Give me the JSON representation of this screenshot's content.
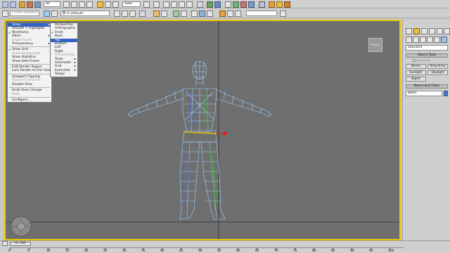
{
  "toolbar": {
    "filter_value": "All",
    "refcoord_value": "View",
    "selection_set_placeholder": "Create Selection Set",
    "layer_value": "0 (default)"
  },
  "viewport_menu": {
    "items": [
      {
        "label": "Views",
        "state": "highlight-sub"
      },
      {
        "label": "Smooth + Highlights",
        "state": ""
      },
      {
        "label": "Wireframe",
        "state": "checked"
      },
      {
        "label": "Other",
        "state": "sub"
      },
      {
        "label": "Edged Faces",
        "state": "disabled"
      },
      {
        "label": "Transparency",
        "state": "sub"
      },
      {
        "label": "-"
      },
      {
        "label": "Show Grid",
        "state": "checked"
      },
      {
        "label": "Show Background",
        "state": "disabled"
      },
      {
        "label": "Show Statistics",
        "state": ""
      },
      {
        "label": "Show Safe Frame",
        "state": ""
      },
      {
        "label": "-"
      },
      {
        "label": "Edit Render Region",
        "state": ""
      },
      {
        "label": "Lock Render to this View",
        "state": ""
      },
      {
        "label": "-"
      },
      {
        "label": "Viewport Clipping",
        "state": ""
      },
      {
        "label": "Texture Correction",
        "state": "disabled"
      },
      {
        "label": "Disable View",
        "state": ""
      },
      {
        "label": "-"
      },
      {
        "label": "Undo View Change",
        "state": ""
      },
      {
        "label": "Redo",
        "state": "disabled"
      },
      {
        "label": "-"
      },
      {
        "label": "Configure...",
        "state": ""
      }
    ]
  },
  "views_submenu": {
    "items": [
      {
        "label": "Perspective",
        "state": ""
      },
      {
        "label": "Orthographic",
        "state": ""
      },
      {
        "label": "Front",
        "state": "checked"
      },
      {
        "label": "Back",
        "state": ""
      },
      {
        "label": "Top",
        "state": "highlight"
      },
      {
        "label": "Bottom",
        "state": ""
      },
      {
        "label": "Left",
        "state": ""
      },
      {
        "label": "Right",
        "state": ""
      },
      {
        "label": "ActiveShade",
        "state": "disabled"
      },
      {
        "label": "Track",
        "state": "sub"
      },
      {
        "label": "Schematic",
        "state": "sub"
      },
      {
        "label": "Grid",
        "state": "sub"
      },
      {
        "label": "Extended",
        "state": "sub"
      },
      {
        "label": "Shape",
        "state": ""
      }
    ]
  },
  "viewcube": {
    "label": "FRONT"
  },
  "command_panel": {
    "category_value": "Standard",
    "object_type_header": "Object Type",
    "autogrid_label": "AutoGrid",
    "buttons": [
      "Bones",
      "Ring Array",
      "Sunlight",
      "Daylight",
      "Biped"
    ],
    "name_color_header": "Name and Color",
    "name_value": "Bip01"
  },
  "timeline": {
    "slider_label": "0 / 100",
    "ticks": [
      "0",
      "5",
      "10",
      "15",
      "20",
      "25",
      "30",
      "35",
      "40",
      "45",
      "50",
      "55",
      "60",
      "65",
      "70",
      "75",
      "80",
      "85",
      "90",
      "95",
      "100"
    ]
  },
  "colors": {
    "viewport_bg": "#6f6f6f",
    "active_border": "#e8c800",
    "wire_blue": "#9fd4ff",
    "wire_green": "#3fbf3f",
    "wire_yellow": "#e0c000",
    "menu_highlight": "#3163c5"
  }
}
